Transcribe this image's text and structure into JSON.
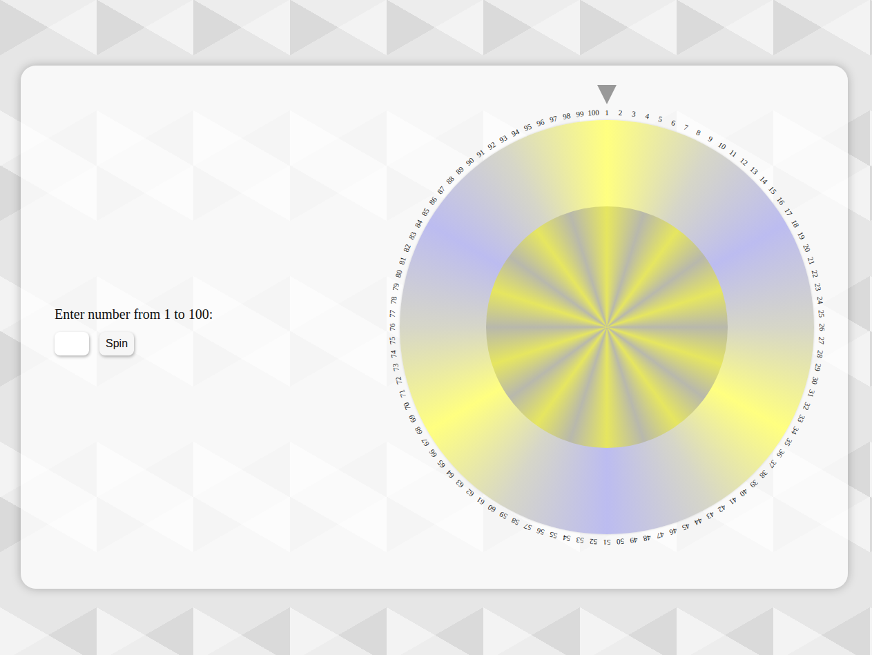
{
  "form": {
    "label": "Enter number from 1 to 100:",
    "input_value": "",
    "button": "Spin"
  },
  "wheel": {
    "numbers": [
      "1",
      "2",
      "3",
      "4",
      "5",
      "6",
      "7",
      "8",
      "9",
      "10",
      "11",
      "12",
      "13",
      "14",
      "15",
      "16",
      "17",
      "18",
      "19",
      "20",
      "21",
      "22",
      "23",
      "24",
      "25",
      "26",
      "27",
      "28",
      "29",
      "30",
      "31",
      "32",
      "33",
      "34",
      "35",
      "36",
      "37",
      "38",
      "39",
      "40",
      "41",
      "42",
      "43",
      "44",
      "45",
      "46",
      "47",
      "48",
      "49",
      "50",
      "51",
      "52",
      "53",
      "54",
      "55",
      "56",
      "57",
      "58",
      "59",
      "60",
      "61",
      "62",
      "63",
      "64",
      "65",
      "66",
      "67",
      "68",
      "69",
      "70",
      "71",
      "72",
      "73",
      "74",
      "75",
      "76",
      "77",
      "78",
      "79",
      "80",
      "81",
      "82",
      "83",
      "84",
      "85",
      "86",
      "87",
      "88",
      "89",
      "90",
      "91",
      "92",
      "93",
      "94",
      "95",
      "96",
      "97",
      "98",
      "99",
      "100"
    ]
  }
}
